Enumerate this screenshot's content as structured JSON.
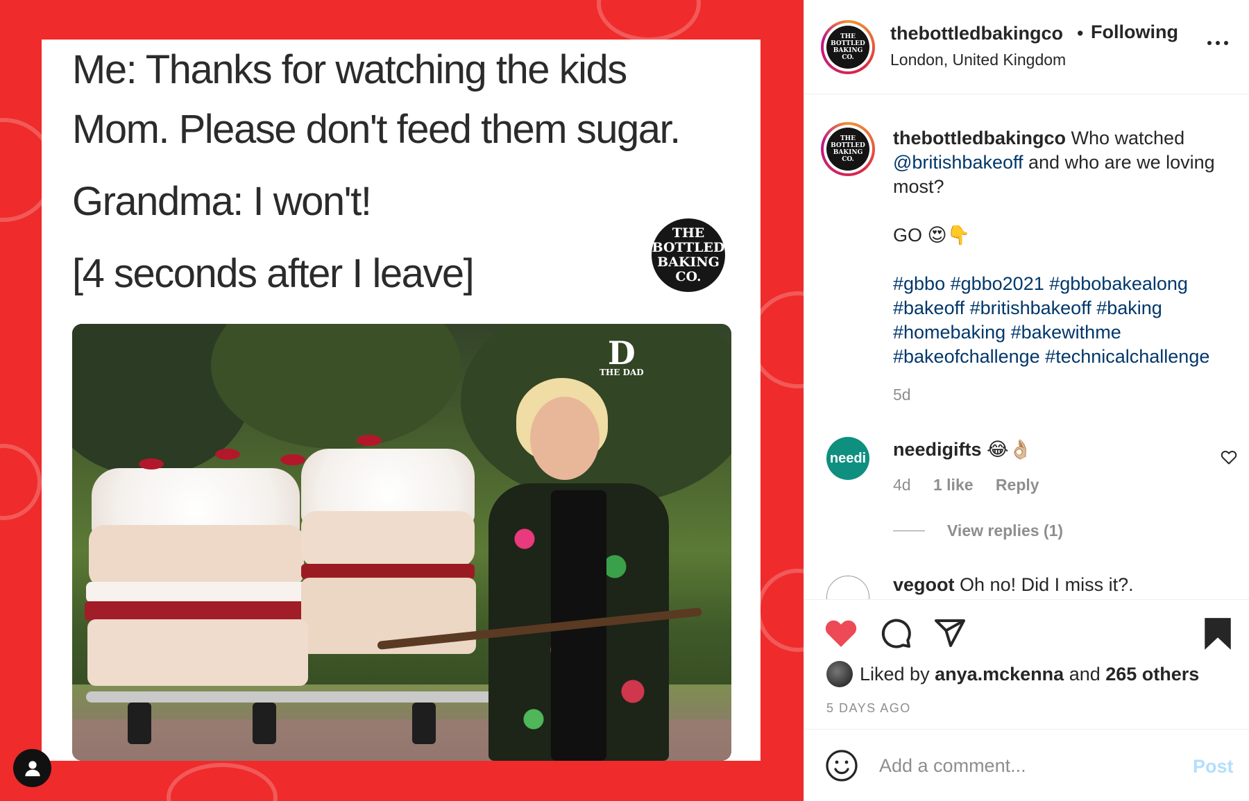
{
  "post": {
    "username": "thebottledbakingco",
    "follow_status": "Following",
    "separator": "•",
    "location": "London, United Kingdom",
    "more_icon": "more-horizontal-icon",
    "avatar_text": [
      "THE",
      "BOTTLED",
      "BAKING",
      "CO."
    ]
  },
  "media": {
    "meme_lines": [
      "Me: Thanks for watching the kids",
      "Mom. Please don't feed them sugar.",
      "Grandma: I won't!",
      "[4 seconds after I leave]"
    ],
    "logo_lines": [
      "THE",
      "BOTTLED",
      "BAKING",
      "CO."
    ],
    "watermark_small": "THE DAD",
    "watermark_big": "D",
    "background_color": "#ef2b2b"
  },
  "caption": {
    "username": "thebottledbakingco",
    "text_before_mention": " Who watched ",
    "mention": "@britishbakeoff",
    "text_after_mention": " and who are we loving most?",
    "go_line": "GO 😍👇",
    "hashtags": "#gbbo #gbbo2021 #gbbobakealong #bakeoff #britishbakeoff #baking #homebaking #bakewithme #bakeofchallenge #technicalchallenge",
    "time": "5d"
  },
  "comments": [
    {
      "username": "needigifts",
      "text": "😂👌🏼",
      "avatar_text": "needi",
      "time": "4d",
      "likes": "1 like",
      "reply_label": "Reply",
      "view_replies": "View replies (1)"
    },
    {
      "username": "vegoot",
      "text": "Oh no! Did I miss it?."
    }
  ],
  "actions": {
    "like_icon": "heart-filled-icon",
    "comment_icon": "comment-icon",
    "share_icon": "send-icon",
    "save_icon": "bookmark-filled-icon",
    "liked_by_prefix": "Liked by ",
    "liked_by_user": "anya.mckenna",
    "liked_by_middle": " and ",
    "liked_by_others": "265 others",
    "date": "5 DAYS AGO",
    "like_color": "#ed4956"
  },
  "comment_box": {
    "placeholder": "Add a comment...",
    "post_label": "Post",
    "emoji_icon": "smiley-icon"
  }
}
